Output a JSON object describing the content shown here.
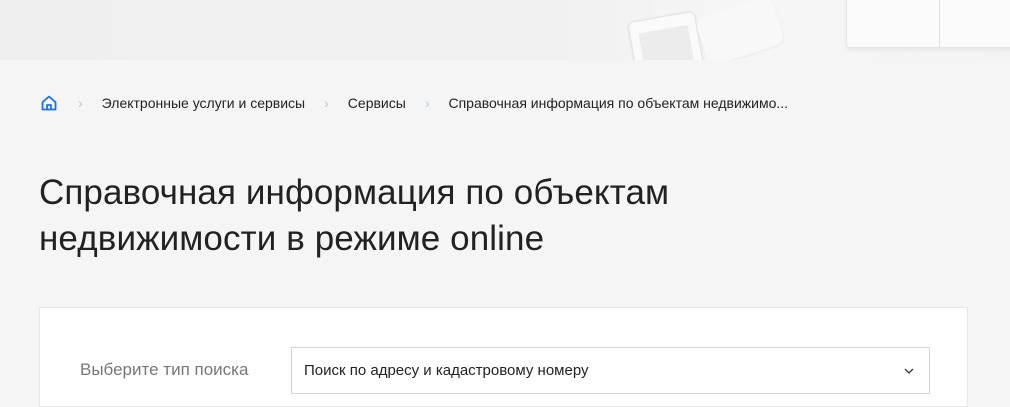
{
  "breadcrumb": {
    "home_icon": "home-icon",
    "items": [
      "Электронные услуги и сервисы",
      "Сервисы",
      "Справочная информация по объектам недвижимо..."
    ]
  },
  "page": {
    "title_line1": "Справочная информация по объектам",
    "title_line2": "недвижимости в режиме online"
  },
  "search": {
    "label": "Выберите тип поиска",
    "selected_value": "Поиск по адресу и кадастровому номеру",
    "chevron_icon": "chevron-down-icon"
  },
  "colors": {
    "accent": "#1a73e8",
    "separator": "#b9c7dc",
    "background": "#f5f5f5"
  }
}
